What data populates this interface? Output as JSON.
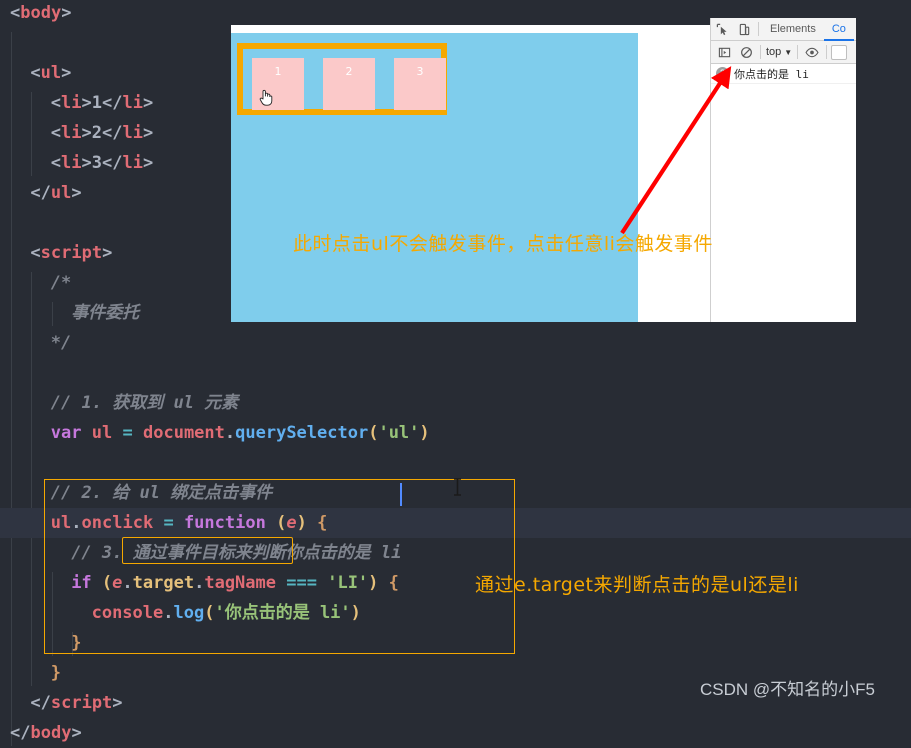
{
  "editor": {
    "code_lines": [
      {
        "indent": 0,
        "tokens": [
          {
            "c": "t-punc",
            "s": "<"
          },
          {
            "c": "t-tag",
            "s": "body"
          },
          {
            "c": "t-punc",
            "s": ">"
          }
        ]
      },
      {
        "indent": 0,
        "tokens": []
      },
      {
        "indent": 2,
        "tokens": [
          {
            "c": "t-punc",
            "s": "<"
          },
          {
            "c": "t-tag",
            "s": "ul"
          },
          {
            "c": "t-punc",
            "s": ">"
          }
        ]
      },
      {
        "indent": 4,
        "tokens": [
          {
            "c": "t-punc",
            "s": "<"
          },
          {
            "c": "t-tag",
            "s": "li"
          },
          {
            "c": "t-punc",
            "s": ">"
          },
          {
            "c": "t-text",
            "s": "1"
          },
          {
            "c": "t-punc",
            "s": "</"
          },
          {
            "c": "t-tag",
            "s": "li"
          },
          {
            "c": "t-punc",
            "s": ">"
          }
        ]
      },
      {
        "indent": 4,
        "tokens": [
          {
            "c": "t-punc",
            "s": "<"
          },
          {
            "c": "t-tag",
            "s": "li"
          },
          {
            "c": "t-punc",
            "s": ">"
          },
          {
            "c": "t-text",
            "s": "2"
          },
          {
            "c": "t-punc",
            "s": "</"
          },
          {
            "c": "t-tag",
            "s": "li"
          },
          {
            "c": "t-punc",
            "s": ">"
          }
        ]
      },
      {
        "indent": 4,
        "tokens": [
          {
            "c": "t-punc",
            "s": "<"
          },
          {
            "c": "t-tag",
            "s": "li"
          },
          {
            "c": "t-punc",
            "s": ">"
          },
          {
            "c": "t-text",
            "s": "3"
          },
          {
            "c": "t-punc",
            "s": "</"
          },
          {
            "c": "t-tag",
            "s": "li"
          },
          {
            "c": "t-punc",
            "s": ">"
          }
        ]
      },
      {
        "indent": 2,
        "tokens": [
          {
            "c": "t-punc",
            "s": "</"
          },
          {
            "c": "t-tag",
            "s": "ul"
          },
          {
            "c": "t-punc",
            "s": ">"
          }
        ]
      },
      {
        "indent": 0,
        "tokens": []
      },
      {
        "indent": 2,
        "tokens": [
          {
            "c": "t-punc",
            "s": "<"
          },
          {
            "c": "t-tag",
            "s": "script"
          },
          {
            "c": "t-punc",
            "s": ">"
          }
        ]
      },
      {
        "indent": 4,
        "tokens": [
          {
            "c": "t-comment",
            "s": "/*"
          }
        ]
      },
      {
        "indent": 6,
        "tokens": [
          {
            "c": "t-comment",
            "s": "事件委托"
          }
        ]
      },
      {
        "indent": 4,
        "tokens": [
          {
            "c": "t-comment",
            "s": "*/"
          }
        ]
      },
      {
        "indent": 0,
        "tokens": []
      },
      {
        "indent": 4,
        "tokens": [
          {
            "c": "t-comment",
            "s": "// 1. 获取到 ul 元素"
          }
        ]
      },
      {
        "indent": 4,
        "tokens": [
          {
            "c": "t-kw",
            "s": "var"
          },
          {
            "c": "t-plain",
            "s": " "
          },
          {
            "c": "t-var",
            "s": "ul"
          },
          {
            "c": "t-plain",
            "s": " "
          },
          {
            "c": "t-op",
            "s": "="
          },
          {
            "c": "t-plain",
            "s": " "
          },
          {
            "c": "t-var",
            "s": "document"
          },
          {
            "c": "t-punc",
            "s": "."
          },
          {
            "c": "t-fn",
            "s": "querySelector"
          },
          {
            "c": "t-paren",
            "s": "("
          },
          {
            "c": "t-str",
            "s": "'ul'"
          },
          {
            "c": "t-paren",
            "s": ")"
          }
        ]
      },
      {
        "indent": 0,
        "tokens": []
      },
      {
        "indent": 4,
        "tokens": [
          {
            "c": "t-comment",
            "s": "// 2. 给 ul 绑定点击事件"
          }
        ]
      },
      {
        "indent": 4,
        "tokens": [
          {
            "c": "t-var",
            "s": "ul"
          },
          {
            "c": "t-punc",
            "s": "."
          },
          {
            "c": "t-var",
            "s": "onclick"
          },
          {
            "c": "t-plain",
            "s": " "
          },
          {
            "c": "t-op",
            "s": "="
          },
          {
            "c": "t-plain",
            "s": " "
          },
          {
            "c": "t-kw",
            "s": "function"
          },
          {
            "c": "t-plain",
            "s": " "
          },
          {
            "c": "t-paren",
            "s": "("
          },
          {
            "c": "t-param",
            "s": "e"
          },
          {
            "c": "t-paren",
            "s": ")"
          },
          {
            "c": "t-plain",
            "s": " "
          },
          {
            "c": "t-brace",
            "s": "{"
          }
        ],
        "highlight": true
      },
      {
        "indent": 6,
        "tokens": [
          {
            "c": "t-comment",
            "s": "// 3. 通过事件目标来判断你点击的是 li"
          }
        ]
      },
      {
        "indent": 6,
        "tokens": [
          {
            "c": "t-kw",
            "s": "if"
          },
          {
            "c": "t-plain",
            "s": " "
          },
          {
            "c": "t-paren",
            "s": "("
          },
          {
            "c": "t-param",
            "s": "e"
          },
          {
            "c": "t-punc",
            "s": "."
          },
          {
            "c": "t-obj",
            "s": "target"
          },
          {
            "c": "t-punc",
            "s": "."
          },
          {
            "c": "t-var",
            "s": "tagName"
          },
          {
            "c": "t-plain",
            "s": " "
          },
          {
            "c": "t-op",
            "s": "==="
          },
          {
            "c": "t-plain",
            "s": " "
          },
          {
            "c": "t-str",
            "s": "'LI'"
          },
          {
            "c": "t-paren",
            "s": ")"
          },
          {
            "c": "t-plain",
            "s": " "
          },
          {
            "c": "t-brace",
            "s": "{"
          }
        ]
      },
      {
        "indent": 8,
        "tokens": [
          {
            "c": "t-var",
            "s": "console"
          },
          {
            "c": "t-punc",
            "s": "."
          },
          {
            "c": "t-fn",
            "s": "log"
          },
          {
            "c": "t-paren",
            "s": "("
          },
          {
            "c": "t-str",
            "s": "'你点击的是 li'"
          },
          {
            "c": "t-paren",
            "s": ")"
          }
        ]
      },
      {
        "indent": 6,
        "tokens": [
          {
            "c": "t-brace",
            "s": "}"
          }
        ]
      },
      {
        "indent": 4,
        "tokens": [
          {
            "c": "t-brace",
            "s": "}"
          }
        ]
      },
      {
        "indent": 2,
        "tokens": [
          {
            "c": "t-punc",
            "s": "</"
          },
          {
            "c": "t-tag",
            "s": "script"
          },
          {
            "c": "t-punc",
            "s": ">"
          }
        ]
      },
      {
        "indent": 0,
        "tokens": [
          {
            "c": "t-punc",
            "s": "</"
          },
          {
            "c": "t-tag",
            "s": "body"
          },
          {
            "c": "t-punc",
            "s": ">"
          }
        ]
      }
    ]
  },
  "preview": {
    "background_color": "#7fcdec",
    "ul_border_color": "#f5a800",
    "li_items": [
      {
        "label": "1"
      },
      {
        "label": "2"
      },
      {
        "label": "3"
      }
    ],
    "cursor": "pointer-hand-cursor"
  },
  "devtools": {
    "tabs": [
      {
        "label": "Elements",
        "active": false
      },
      {
        "label": "Co",
        "active": true
      }
    ],
    "top_icons": [
      {
        "name": "inspect-element-icon"
      },
      {
        "name": "device-toolbar-icon"
      }
    ],
    "toolbar": {
      "sidebar_icon": "console-sidebar-icon",
      "clear_icon": "clear-console-icon",
      "context_label": "top",
      "context_caret": "▼",
      "eye_icon": "live-expression-eye-icon"
    },
    "console_messages": [
      {
        "count": "3",
        "text": "你点击的是 li"
      }
    ]
  },
  "annotations": {
    "preview_note": "此时点击ul不会触发事件，点击任意li会触发事件",
    "code_note": "通过e.target来判断点击的是ul还是li",
    "arrow_color": "#ff0000"
  },
  "watermark": {
    "text": "CSDN @不知名的小F5"
  }
}
